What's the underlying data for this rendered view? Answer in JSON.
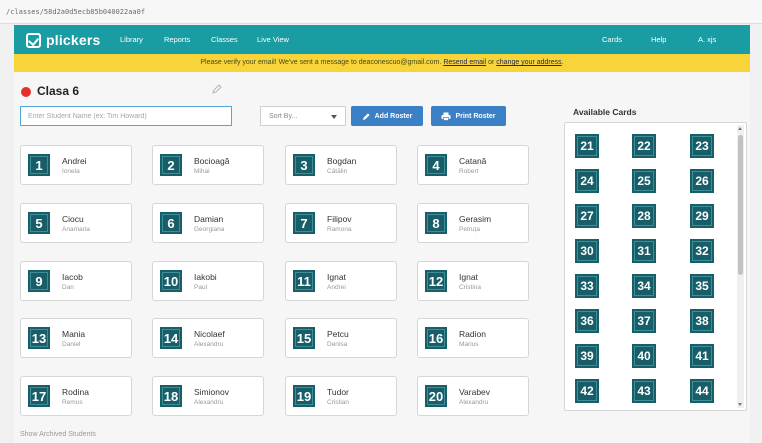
{
  "browser": {
    "url": "/classes/58d2a0d5ecb85b040022aa0f"
  },
  "nav": {
    "logo_text": "plickers",
    "library": "Library",
    "reports": "Reports",
    "classes": "Classes",
    "liveview": "Live View",
    "cards": "Cards",
    "help": "Help",
    "user": "A. xjs"
  },
  "banner": {
    "message": "Please verify your email! We've sent a message to deaconescuo@gmail.com.",
    "resend": "Resend email",
    "or": "or",
    "change": "change your address",
    "end": "."
  },
  "class_info": {
    "name": "Clasa 6"
  },
  "search": {
    "placeholder": "Enter Student Name (ex: Tim Howard)"
  },
  "sort": {
    "label": "Sort By..."
  },
  "buttons": {
    "add_roster": "Add Roster",
    "print_roster": "Print Roster"
  },
  "students": [
    {
      "number": "1",
      "last": "Andrei",
      "first": "Ionela"
    },
    {
      "number": "2",
      "last": "Bocioagă",
      "first": "Mihai"
    },
    {
      "number": "3",
      "last": "Bogdan",
      "first": "Cătălin"
    },
    {
      "number": "4",
      "last": "Catană",
      "first": "Robert"
    },
    {
      "number": "5",
      "last": "Ciocu",
      "first": "Anamaria"
    },
    {
      "number": "6",
      "last": "Damian",
      "first": "Georgiana"
    },
    {
      "number": "7",
      "last": "Filipov",
      "first": "Ramona"
    },
    {
      "number": "8",
      "last": "Gerasim",
      "first": "Petruța"
    },
    {
      "number": "9",
      "last": "Iacob",
      "first": "Dan"
    },
    {
      "number": "10",
      "last": "Iakobi",
      "first": "Paul"
    },
    {
      "number": "11",
      "last": "Ignat",
      "first": "Andrei"
    },
    {
      "number": "12",
      "last": "Ignat",
      "first": "Cristina"
    },
    {
      "number": "13",
      "last": "Mania",
      "first": "Daniel"
    },
    {
      "number": "14",
      "last": "Nicolaef",
      "first": "Alexandru"
    },
    {
      "number": "15",
      "last": "Petcu",
      "first": "Denisa"
    },
    {
      "number": "16",
      "last": "Radion",
      "first": "Marius"
    },
    {
      "number": "17",
      "last": "Rodina",
      "first": "Remus"
    },
    {
      "number": "18",
      "last": "Simionov",
      "first": "Alexandru"
    },
    {
      "number": "19",
      "last": "Tudor",
      "first": "Cristian"
    },
    {
      "number": "20",
      "last": "Varabev",
      "first": "Alexandru"
    }
  ],
  "available": {
    "title": "Available Cards",
    "cards": [
      "21",
      "22",
      "23",
      "24",
      "25",
      "26",
      "27",
      "28",
      "29",
      "30",
      "31",
      "32",
      "33",
      "34",
      "35",
      "36",
      "37",
      "38",
      "39",
      "40",
      "41",
      "42",
      "43",
      "44"
    ]
  },
  "footer": {
    "show_archived": "Show Archived Students"
  },
  "colors": {
    "nav": "#1a9ca3",
    "banner": "#f6d43a",
    "card": "#175e69",
    "button": "#3b7fc4",
    "dot": "#e33129"
  }
}
